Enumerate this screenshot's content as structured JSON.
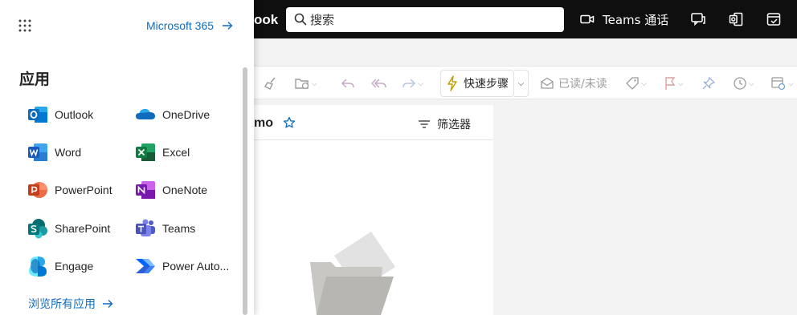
{
  "topbar": {
    "app_title": "ook",
    "search_placeholder": "搜索",
    "teams_call_label": "Teams 通话",
    "icons": [
      "video-icon",
      "chat-icon",
      "office-icon",
      "todo-icon"
    ]
  },
  "ribbon": {
    "quick_steps_label": "快速步骤",
    "read_unread_label": "已读/未读"
  },
  "mail": {
    "folder_title": "mo",
    "filter_label": "筛选器"
  },
  "drawer": {
    "m365_label": "Microsoft 365",
    "heading": "应用",
    "apps": [
      {
        "label": "Outlook",
        "icon": "outlook-icon"
      },
      {
        "label": "OneDrive",
        "icon": "onedrive-icon"
      },
      {
        "label": "Word",
        "icon": "word-icon"
      },
      {
        "label": "Excel",
        "icon": "excel-icon"
      },
      {
        "label": "PowerPoint",
        "icon": "powerpoint-icon"
      },
      {
        "label": "OneNote",
        "icon": "onenote-icon"
      },
      {
        "label": "SharePoint",
        "icon": "sharepoint-icon"
      },
      {
        "label": "Teams",
        "icon": "teams-icon"
      },
      {
        "label": "Engage",
        "icon": "engage-icon"
      },
      {
        "label": "Power Auto...",
        "icon": "power-automate-icon"
      }
    ],
    "browse_all_label": "浏览所有应用"
  },
  "colors": {
    "topbar_bg": "#0f0f0f",
    "link_blue": "#0f6cbd",
    "outlook": "#0f6cbd",
    "word": "#185abd",
    "excel": "#107c41",
    "powerpoint": "#c43e1c",
    "onenote": "#7719aa",
    "sharepoint": "#036c70",
    "teams": "#5059c9"
  }
}
